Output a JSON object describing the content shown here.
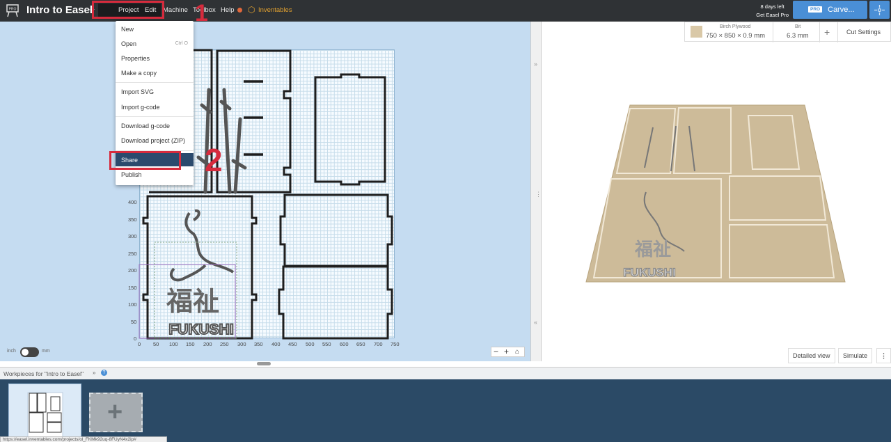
{
  "app": {
    "title": "Intro to Easel",
    "logo_icon": "easel-pro-icon"
  },
  "nav": {
    "project": "Project",
    "edit": "Edit",
    "machine": "Machine",
    "toolbox": "Toolbox",
    "help": "Help",
    "inventables": "Inventables"
  },
  "trial": {
    "days": "8 days left",
    "cta": "Get Easel Pro"
  },
  "carve": {
    "badge": "PRO",
    "label": "Carve..."
  },
  "annotations": {
    "step1": "1",
    "step2": "2"
  },
  "project_menu": {
    "items": [
      {
        "label": "New"
      },
      {
        "label": "Open",
        "shortcut": "Ctrl O"
      },
      {
        "label": "Properties"
      },
      {
        "label": "Make a copy"
      },
      {
        "label": "Import SVG"
      },
      {
        "label": "Import g-code"
      },
      {
        "label": "Download g-code"
      },
      {
        "label": "Download project (ZIP)"
      },
      {
        "label": "Share"
      },
      {
        "label": "Publish"
      }
    ]
  },
  "canvas": {
    "x_ticks": [
      "0",
      "50",
      "100",
      "150",
      "200",
      "250",
      "300",
      "350",
      "400",
      "450",
      "500",
      "550",
      "600",
      "650",
      "700",
      "750"
    ],
    "y_ticks": [
      "400",
      "350",
      "300",
      "250",
      "200",
      "150",
      "100",
      "50",
      "0"
    ],
    "unit_left": "inch",
    "unit_right": "mm",
    "design_text": "FUKUSHI",
    "design_kanji": "福祉"
  },
  "material": {
    "name": "Birch Plywood",
    "dims": "750 × 850 × 0.9 mm",
    "bit_label": "Bit",
    "bit_value": "6.3 mm",
    "cut_settings": "Cut Settings"
  },
  "preview": {
    "detailed": "Detailed view",
    "simulate": "Simulate"
  },
  "workpieces": {
    "label": "Workpieces for \"Intro to Easel\""
  },
  "status_url": "https://easel.inventables.com/projects/ol_FKMk92uq-8FUyN4x2ip#"
}
